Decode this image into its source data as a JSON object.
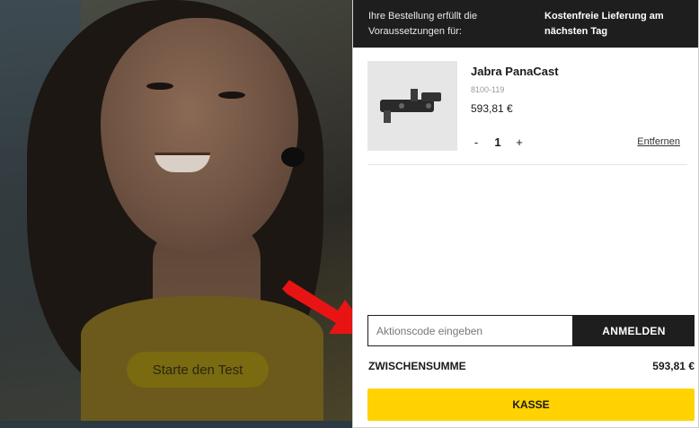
{
  "hero": {
    "cta_label": "Starte den Test"
  },
  "cart": {
    "promo": {
      "label": "Ihre Bestellung erfüllt die Voraussetzungen für:",
      "value": "Kostenfreie Lieferung am nächsten Tag"
    },
    "item": {
      "name": "Jabra PanaCast",
      "sku": "8100-119",
      "price": "593,81 €",
      "qty_minus": "-",
      "quantity": "1",
      "qty_plus": "+",
      "remove_label": "Entfernen"
    },
    "coupon": {
      "placeholder": "Aktionscode eingeben",
      "apply_label": "ANMELDEN"
    },
    "subtotal": {
      "label": "ZWISCHENSUMME",
      "value": "593,81 €"
    },
    "checkout_label": "KASSE"
  },
  "colors": {
    "accent": "#ffd200",
    "dark": "#1e1e1e",
    "annotation_arrow": "#e81414"
  },
  "icons": {
    "annotation": "arrow-right-icon"
  }
}
